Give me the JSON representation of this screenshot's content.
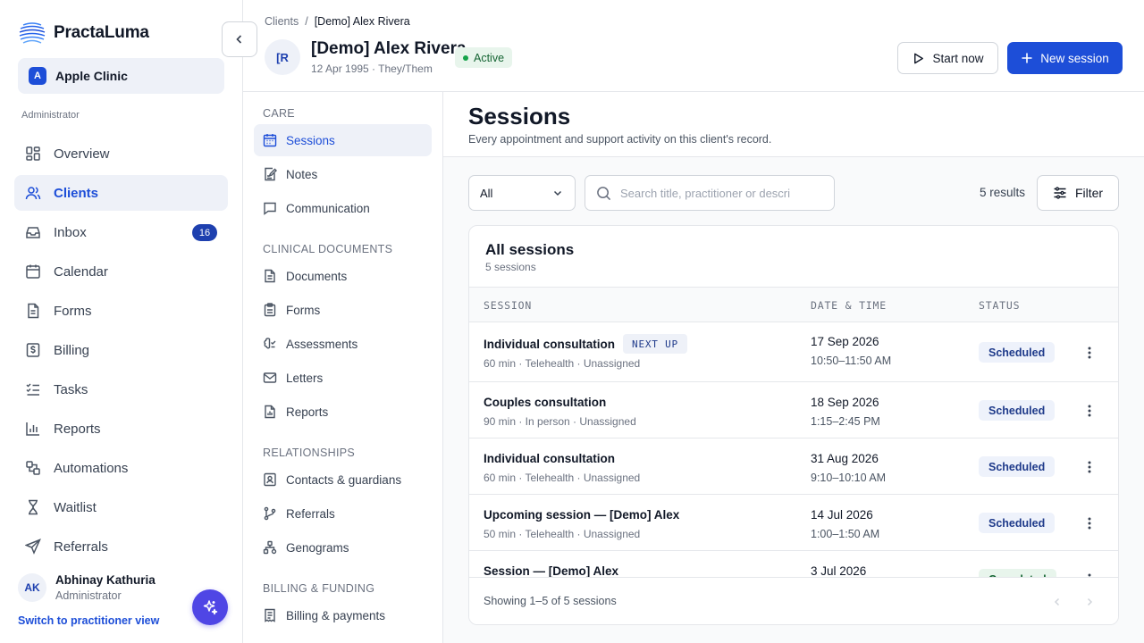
{
  "app": {
    "name": "PractaLuma"
  },
  "colors": {
    "accent": "#1d4ed8",
    "active_bg": "#eef1f8",
    "success": "#16a34a"
  },
  "clinic": {
    "badge": "A",
    "name": "Apple Clinic"
  },
  "sidebar": {
    "role_label": "Administrator",
    "items": [
      {
        "label": "Overview",
        "icon": "grid-icon"
      },
      {
        "label": "Clients",
        "icon": "users-icon",
        "active": true
      },
      {
        "label": "Inbox",
        "icon": "inbox-icon",
        "badge": "16"
      },
      {
        "label": "Calendar",
        "icon": "calendar-icon"
      },
      {
        "label": "Forms",
        "icon": "form-icon"
      },
      {
        "label": "Billing",
        "icon": "dollar-icon"
      },
      {
        "label": "Tasks",
        "icon": "tasks-icon"
      },
      {
        "label": "Reports",
        "icon": "chart-icon"
      },
      {
        "label": "Automations",
        "icon": "automation-icon"
      },
      {
        "label": "Waitlist",
        "icon": "hourglass-icon"
      },
      {
        "label": "Referrals",
        "icon": "send-icon"
      }
    ],
    "user": {
      "initials": "AK",
      "name": "Abhinay Kathuria",
      "role": "Administrator"
    },
    "switch_view": "Switch to practitioner view"
  },
  "header": {
    "breadcrumb": {
      "parent": "Clients",
      "separator": "/",
      "current": "[Demo] Alex Rivera"
    },
    "client": {
      "initials": "[R",
      "name": "[Demo] Alex Rivera",
      "subtitle": "12 Apr 1995 · They/Them",
      "status": "Active"
    },
    "start_label": "Start now",
    "new_label": "New session"
  },
  "subnav": {
    "sections": {
      "care": "CARE",
      "clinical": "CLINICAL DOCUMENTS",
      "relationships": "RELATIONSHIPS",
      "billing": "BILLING & FUNDING"
    },
    "items": {
      "sessions": "Sessions",
      "notes": "Notes",
      "communication": "Communication",
      "documents": "Documents",
      "forms": "Forms",
      "assessments": "Assessments",
      "letters": "Letters",
      "reports": "Reports",
      "contacts": "Contacts & guardians",
      "referrals": "Referrals",
      "genograms": "Genograms",
      "billing": "Billing & payments"
    }
  },
  "main": {
    "title": "Sessions",
    "subtitle": "Every appointment and support activity on this client's record.",
    "filter_select": "All",
    "search_placeholder": "Search title, practitioner or description",
    "results": "5 results",
    "filter_label": "Filter",
    "card": {
      "title": "All sessions",
      "subtitle": "5 sessions",
      "columns": {
        "session": "SESSION",
        "datetime": "DATE & TIME",
        "status": "STATUS"
      },
      "rows": [
        {
          "title": "Individual consultation",
          "tag": "NEXT UP",
          "sub": "60 min · Telehealth · Unassigned",
          "date": "17 Sep 2026",
          "time": "10:50–11:50 AM",
          "status": "Scheduled"
        },
        {
          "title": "Couples consultation",
          "sub": "90 min · In person · Unassigned",
          "date": "18 Sep 2026",
          "time": "1:15–2:45 PM",
          "status": "Scheduled"
        },
        {
          "title": "Individual consultation",
          "sub": "60 min · Telehealth · Unassigned",
          "date": "31 Aug 2026",
          "time": "9:10–10:10 AM",
          "status": "Scheduled"
        },
        {
          "title": "Upcoming session — [Demo] Alex",
          "sub": "50 min · Telehealth · Unassigned",
          "date": "14 Jul 2026",
          "time": "1:00–1:50 AM",
          "status": "Scheduled"
        },
        {
          "title": "Session — [Demo] Alex",
          "sub": "",
          "date": "3 Jul 2026",
          "time": "",
          "status": "Completed"
        }
      ],
      "footer": "Showing 1–5 of 5 sessions"
    }
  }
}
